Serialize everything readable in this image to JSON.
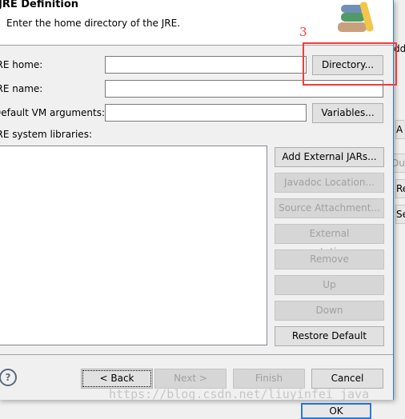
{
  "dialog": {
    "title": "JRE Definition",
    "description": "Enter the home directory of the JRE.",
    "fields": {
      "jre_home_label": "JRE home:",
      "jre_home_value": "",
      "jre_name_label": "JRE name:",
      "jre_name_value": "",
      "vm_args_label": "Default VM arguments:",
      "vm_args_value": "",
      "libs_label": "JRE system libraries:"
    },
    "buttons": {
      "directory": "Directory...",
      "variables": "Variables...",
      "add_jars": "Add External JARs...",
      "javadoc": "Javadoc Location...",
      "source": "Source Attachment...",
      "annotations": "External annotations...",
      "remove": "Remove",
      "up": "Up",
      "down": "Down",
      "restore": "Restore Default"
    },
    "footer": {
      "back": "< Back",
      "next": "Next >",
      "finish": "Finish",
      "cancel": "Cancel"
    }
  },
  "annotation": {
    "step": "3",
    "color": "#f03c3c"
  },
  "watermark": "https://blog.csdn.net/liuyinfei_java",
  "background_window": {
    "labels": [
      "dd",
      "A",
      "Dup",
      "Re",
      "Se",
      "OK"
    ]
  }
}
